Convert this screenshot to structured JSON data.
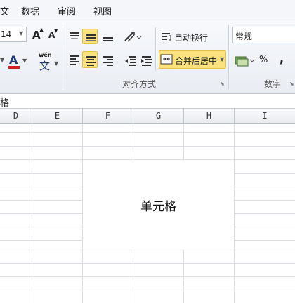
{
  "menu": {
    "items": [
      "文",
      "数据",
      "审阅",
      "视图"
    ]
  },
  "ribbon": {
    "font_size": "14",
    "font_grow": "A",
    "font_shrink": "A",
    "font_color_glyph": "A",
    "phonetic_top": "wén",
    "phonetic_bottom": "文",
    "wrap_text": "自动换行",
    "merge_center": "合并后居中",
    "number_format": "常规",
    "percent": "%",
    "comma": ",",
    "alignment_label": "对齐方式",
    "number_label": "数字"
  },
  "formula_bar": {
    "content": "格"
  },
  "columns": [
    "D",
    "E",
    "F",
    "G",
    "H",
    "I"
  ],
  "merged_cell": {
    "text": "单元格"
  },
  "colors": {
    "active_highlight": "#fbe27e",
    "font_color_red": "#d0231f"
  }
}
